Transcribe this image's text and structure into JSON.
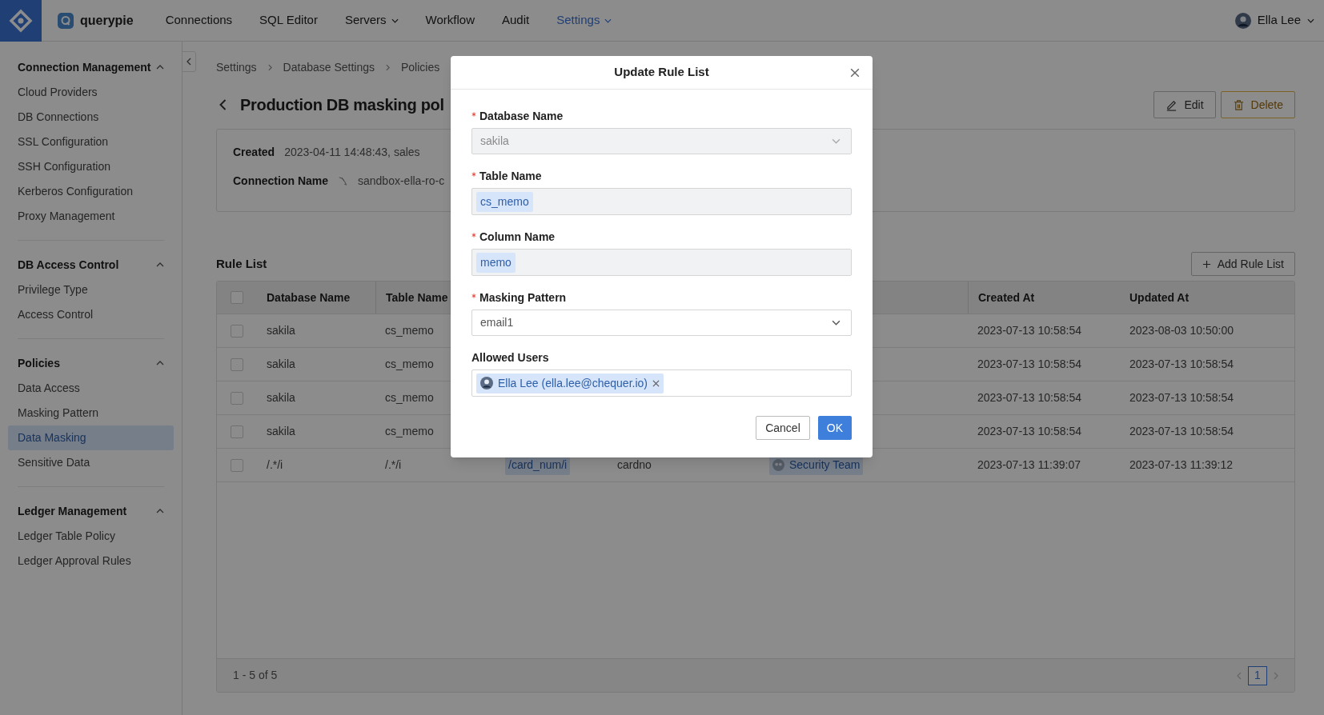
{
  "nav": {
    "brand": "querypie",
    "items": [
      {
        "label": "Connections",
        "selected": false,
        "has_menu": false
      },
      {
        "label": "SQL Editor",
        "selected": false,
        "has_menu": false
      },
      {
        "label": "Servers",
        "selected": false,
        "has_menu": true
      },
      {
        "label": "Workflow",
        "selected": false,
        "has_menu": false
      },
      {
        "label": "Audit",
        "selected": false,
        "has_menu": false
      },
      {
        "label": "Settings",
        "selected": true,
        "has_menu": true
      }
    ],
    "user": "Ella Lee"
  },
  "sidebar": {
    "sections": [
      {
        "title": "Connection Management",
        "expanded": true,
        "items": [
          {
            "label": "Cloud Providers",
            "selected": false
          },
          {
            "label": "DB Connections",
            "selected": false
          },
          {
            "label": "SSL Configuration",
            "selected": false
          },
          {
            "label": "SSH Configuration",
            "selected": false
          },
          {
            "label": "Kerberos Configuration",
            "selected": false
          },
          {
            "label": "Proxy Management",
            "selected": false
          }
        ]
      },
      {
        "title": "DB Access Control",
        "expanded": true,
        "items": [
          {
            "label": "Privilege Type",
            "selected": false
          },
          {
            "label": "Access Control",
            "selected": false
          }
        ]
      },
      {
        "title": "Policies",
        "expanded": true,
        "items": [
          {
            "label": "Data Access",
            "selected": false
          },
          {
            "label": "Masking Pattern",
            "selected": false
          },
          {
            "label": "Data Masking",
            "selected": true
          },
          {
            "label": "Sensitive Data",
            "selected": false
          }
        ]
      },
      {
        "title": "Ledger Management",
        "expanded": true,
        "items": [
          {
            "label": "Ledger Table Policy",
            "selected": false
          },
          {
            "label": "Ledger Approval Rules",
            "selected": false
          }
        ]
      }
    ]
  },
  "breadcrumb": [
    "Settings",
    "Database Settings",
    "Policies"
  ],
  "page": {
    "title": "Production DB masking pol",
    "actions": [
      {
        "label": "Edit",
        "kind": "edit"
      },
      {
        "label": "Delete",
        "kind": "delete"
      }
    ]
  },
  "info": [
    {
      "label": "Created",
      "value": "2023-04-11 14:48:43, sales"
    },
    {
      "label": "Connection Name",
      "value": "sandbox-ella-ro-c"
    }
  ],
  "rule_list": {
    "title": "Rule List",
    "add_button": "Add Rule List",
    "columns": {
      "database_name": "Database Name",
      "table_name": "Table Name",
      "created_at": "Created At",
      "updated_at": "Updated At"
    },
    "rows": [
      {
        "checked": false,
        "database_name": "sakila",
        "table_name": "cs_memo",
        "created_at": "2023-07-13 10:58:54",
        "updated_at": "2023-08-03 10:50:00"
      },
      {
        "checked": false,
        "database_name": "sakila",
        "table_name": "cs_memo",
        "created_at": "2023-07-13 10:58:54",
        "updated_at": "2023-07-13 10:58:54"
      },
      {
        "checked": false,
        "database_name": "sakila",
        "table_name": "cs_memo",
        "created_at": "2023-07-13 10:58:54",
        "updated_at": "2023-07-13 10:58:54"
      },
      {
        "checked": false,
        "database_name": "sakila",
        "table_name": "cs_memo",
        "created_at": "2023-07-13 10:58:54",
        "updated_at": "2023-07-13 10:58:54"
      },
      {
        "checked": false,
        "database_name": "/.*/i",
        "table_name": "/.*/i",
        "column_3": "/card_num/i",
        "column_4": "cardno",
        "column_5": "Security Team",
        "created_at": "2023-07-13 11:39:07",
        "updated_at": "2023-07-13 11:39:12"
      }
    ],
    "all_checked": false,
    "summary": "1 - 5 of 5",
    "pages": [
      {
        "label": "1",
        "selected": true
      }
    ]
  },
  "modal": {
    "title": "Update Rule List",
    "fields": [
      {
        "label": "Database Name",
        "required": true,
        "kind": "select",
        "value": "sakila",
        "disabled": true
      },
      {
        "label": "Table Name",
        "required": true,
        "kind": "tags",
        "disabled": true,
        "tags": [
          "cs_memo"
        ]
      },
      {
        "label": "Column Name",
        "required": true,
        "kind": "tags",
        "disabled": true,
        "tags": [
          "memo"
        ]
      },
      {
        "label": "Masking Pattern",
        "required": true,
        "kind": "select",
        "value": "email1",
        "disabled": false
      },
      {
        "label": "Allowed Users",
        "required": false,
        "kind": "users",
        "disabled": false,
        "tags": [
          "Ella Lee (ella.lee@chequer.io)"
        ]
      }
    ],
    "buttons": [
      {
        "label": "Cancel",
        "kind": "secondary"
      },
      {
        "label": "OK",
        "kind": "primary"
      }
    ]
  }
}
